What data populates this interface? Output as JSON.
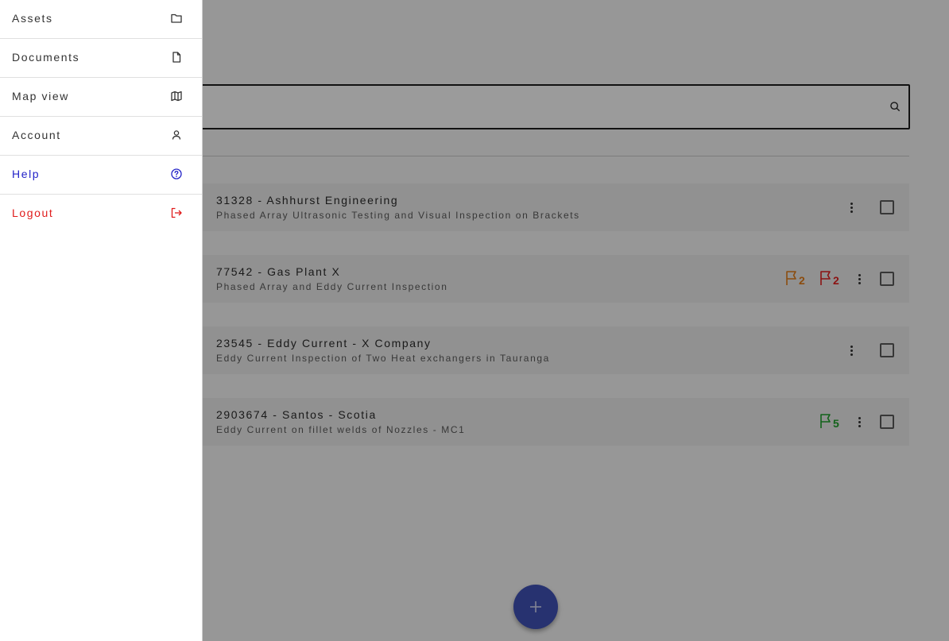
{
  "search": {
    "value": "",
    "placeholder": ""
  },
  "jobs": [
    {
      "title": "31328 - Ashhurst Engineering",
      "description": "Phased Array Ultrasonic Testing and Visual Inspection on Brackets",
      "flags": []
    },
    {
      "title": "77542 - Gas Plant X",
      "description": "Phased Array and Eddy Current Inspection",
      "flags": [
        {
          "count": "2",
          "color": "#e07b18"
        },
        {
          "count": "2",
          "color": "#e02020"
        }
      ]
    },
    {
      "title": "23545 - Eddy Current - X Company",
      "description": "Eddy Current Inspection of Two Heat exchangers in Tauranga",
      "flags": []
    },
    {
      "title": "2903674 - Santos - Scotia",
      "description": "Eddy Current on fillet welds of Nozzles - MC1",
      "flags": [
        {
          "count": "5",
          "color": "#1e9e2a"
        }
      ]
    }
  ],
  "fab": {
    "icon": "plus-icon",
    "color": "#3f51b5"
  },
  "drawer": {
    "items": [
      {
        "label": "Assets",
        "icon": "folder-icon",
        "color": "#333333"
      },
      {
        "label": "Documents",
        "icon": "document-icon",
        "color": "#333333"
      },
      {
        "label": "Map view",
        "icon": "map-icon",
        "color": "#333333"
      },
      {
        "label": "Account",
        "icon": "user-icon",
        "color": "#333333"
      },
      {
        "label": "Help",
        "icon": "help-icon",
        "color": "#2323c8"
      },
      {
        "label": "Logout",
        "icon": "logout-icon",
        "color": "#e01b1b"
      }
    ]
  }
}
